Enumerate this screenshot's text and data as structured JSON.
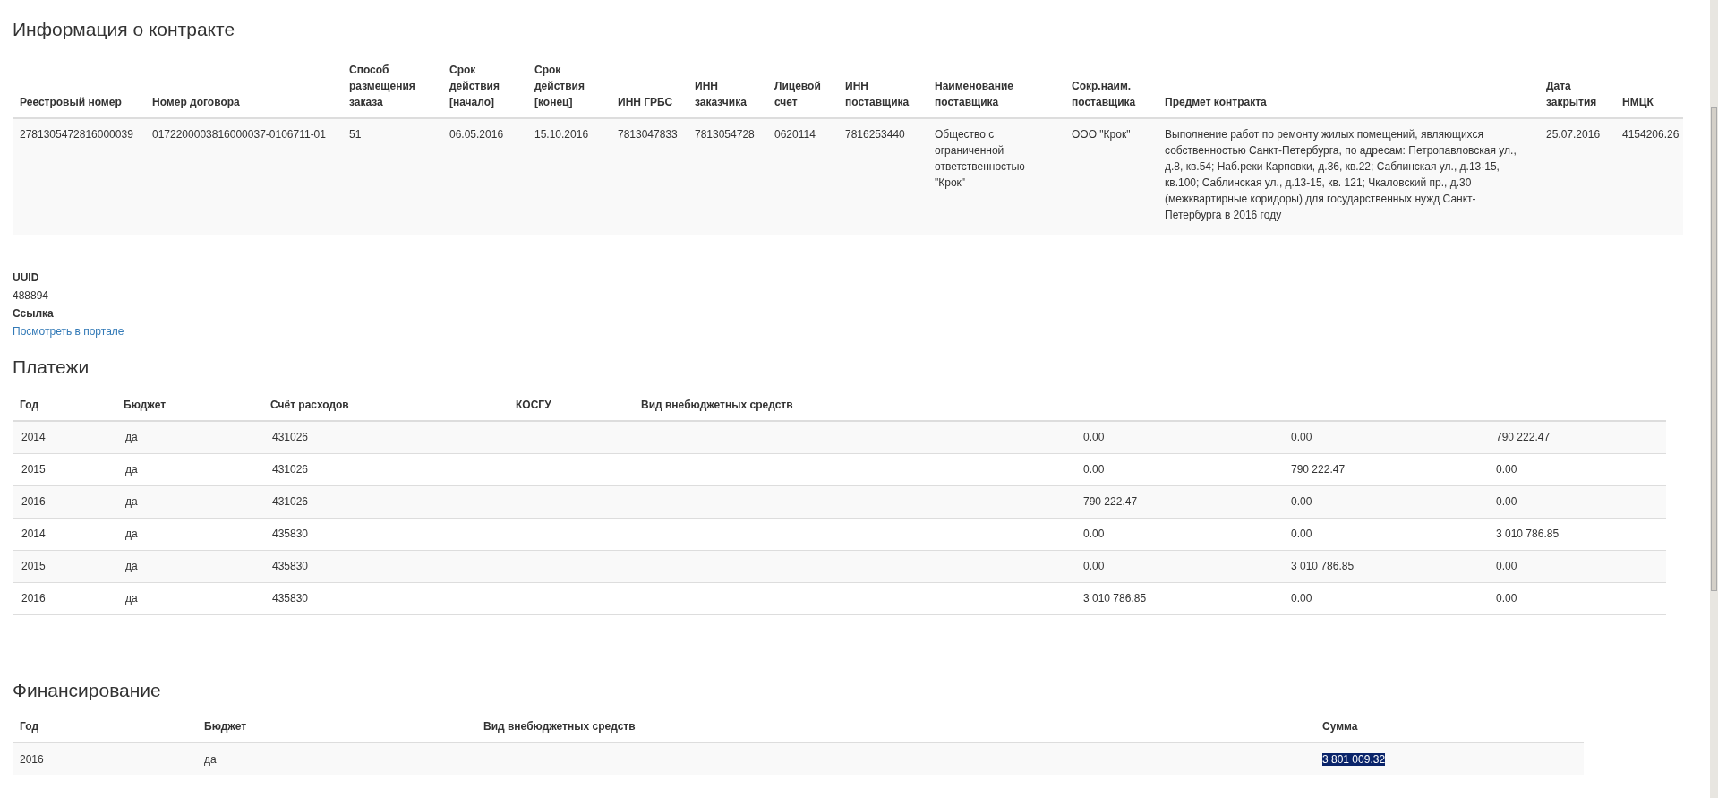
{
  "contract": {
    "title": "Информация о контракте",
    "columns": [
      "Реестровый номер",
      "Номер договора",
      "Способ размещения заказа",
      "Срок действия [начало]",
      "Срок действия [конец]",
      "ИНН ГРБС",
      "ИНН заказчика",
      "Лицевой счет",
      "ИНН поставщика",
      "Наименование поставщика",
      "Сокр.наим. поставщика",
      "Предмет контракта",
      "Дата закрытия",
      "НМЦК"
    ],
    "rows": [
      [
        "2781305472816000039",
        "0172200003816000037-0106711-01",
        "51",
        "06.05.2016",
        "15.10.2016",
        "7813047833",
        "7813054728",
        "0620114",
        "7816253440",
        "Общество с ограниченной ответственностью \"Крок\"",
        "ООО \"Крок\"",
        "Выполнение работ по ремонту жилых помещений, являющихся собственностью Санкт-Петербурга, по адресам: Петропавловская ул., д.8, кв.54; Наб.реки Карповки, д.36, кв.22; Саблинская ул., д.13-15, кв.100; Саблинская ул., д.13-15, кв. 121; Чкаловский пр., д.30 (межквартирные коридоры) для государственных нужд Санкт-Петербурга в 2016 году",
        "25.07.2016",
        "4154206.26"
      ]
    ]
  },
  "details": [
    {
      "label": "UUID",
      "value": "488894",
      "kind": "text"
    },
    {
      "label": "Ссылка",
      "value": "Посмотреть в портале",
      "kind": "link"
    }
  ],
  "payments": {
    "title": "Платежи",
    "columns": [
      "Год",
      "Бюджет",
      "Счёт расходов",
      "КОСГУ",
      "Вид внебюджетных средств",
      "",
      "",
      ""
    ],
    "rows": [
      [
        "2014",
        "да",
        "431026",
        "",
        "",
        "0.00",
        "0.00",
        "790 222.47"
      ],
      [
        "2015",
        "да",
        "431026",
        "",
        "",
        "0.00",
        "790 222.47",
        "0.00"
      ],
      [
        "2016",
        "да",
        "431026",
        "",
        "",
        "790 222.47",
        "0.00",
        "0.00"
      ],
      [
        "2014",
        "да",
        "435830",
        "",
        "",
        "0.00",
        "0.00",
        "3 010 786.85"
      ],
      [
        "2015",
        "да",
        "435830",
        "",
        "",
        "0.00",
        "3 010 786.85",
        "0.00"
      ],
      [
        "2016",
        "да",
        "435830",
        "",
        "",
        "3 010 786.85",
        "0.00",
        "0.00"
      ]
    ]
  },
  "financing": {
    "title": "Финансирование",
    "columns": [
      "Год",
      "Бюджет",
      "Вид внебюджетных средств",
      "Сумма"
    ],
    "rows": [
      {
        "cells": [
          "2016",
          "да",
          "",
          ""
        ],
        "sum": "3 801 009.32",
        "selected": true
      }
    ]
  }
}
